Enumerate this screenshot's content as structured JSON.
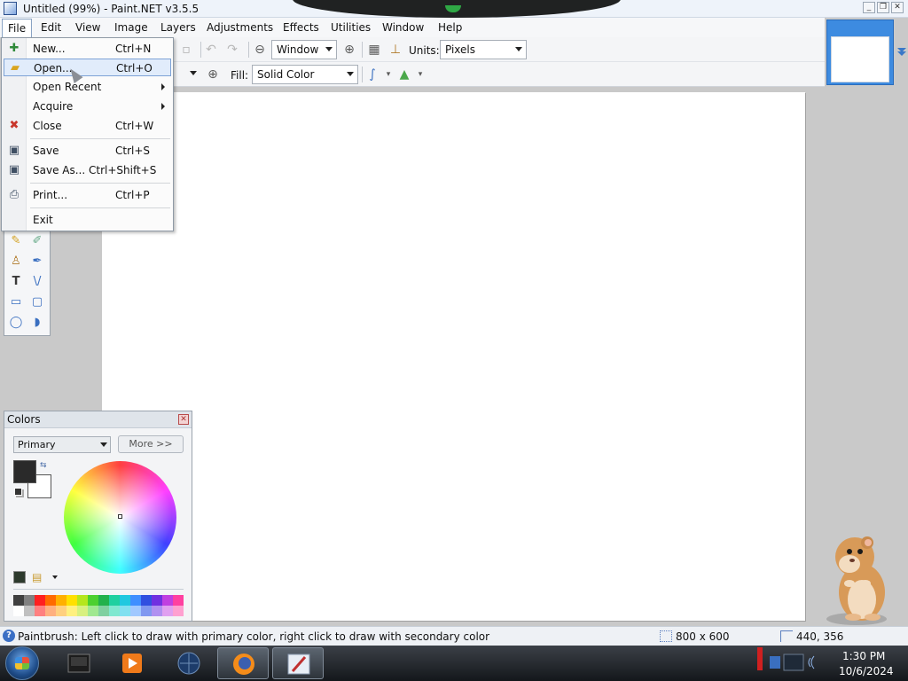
{
  "window": {
    "title": "Untitled (99%) - Paint.NET v3.5.5"
  },
  "menubar": {
    "items": [
      "File",
      "Edit",
      "View",
      "Image",
      "Layers",
      "Adjustments",
      "Effects",
      "Utilities",
      "Window",
      "Help"
    ]
  },
  "toolbar": {
    "zoom_value": "Window",
    "units_label": "Units:",
    "units_value": "Pixels",
    "fill_label": "Fill:",
    "fill_value": "Solid Color"
  },
  "file_menu": {
    "items": [
      {
        "label": "New...",
        "shortcut": "Ctrl+N",
        "icon": "new-document-icon"
      },
      {
        "label": "Open...",
        "shortcut": "Ctrl+O",
        "icon": "open-folder-icon",
        "highlighted": true
      },
      {
        "label": "Open Recent",
        "shortcut": "",
        "submenu": true
      },
      {
        "label": "Acquire",
        "shortcut": "",
        "submenu": true
      },
      {
        "label": "Close",
        "shortcut": "Ctrl+W",
        "icon": "close-document-icon"
      },
      {
        "label": "Save",
        "shortcut": "Ctrl+S",
        "icon": "save-icon"
      },
      {
        "label": "Save As...",
        "shortcut": "Ctrl+Shift+S",
        "icon": "save-as-icon"
      },
      {
        "label": "Print...",
        "shortcut": "Ctrl+P",
        "icon": "print-icon"
      },
      {
        "label": "Exit",
        "shortcut": ""
      }
    ]
  },
  "colors_panel": {
    "title": "Colors",
    "mode": "Primary",
    "more_button": "More >>",
    "primary_color": "#2a2a2a",
    "secondary_color": "#ffffff",
    "palette_row1": [
      "#404040",
      "#808080",
      "#ff2020",
      "#ff6a00",
      "#ffb000",
      "#ffe000",
      "#b5e61d",
      "#4cd030",
      "#22b14c",
      "#20d0a0",
      "#20c8e0",
      "#3f8fff",
      "#3050e0",
      "#7030e0",
      "#c040e0",
      "#ff40a0"
    ],
    "palette_row2": [
      "#ffffff",
      "#c0c0c0",
      "#ff8080",
      "#ffb080",
      "#ffd080",
      "#fff080",
      "#d8f080",
      "#a0e890",
      "#80d0a0",
      "#80e8d0",
      "#80e0f0",
      "#a0c8ff",
      "#8098f0",
      "#b090f0",
      "#e0a0f0",
      "#ffa0d0"
    ]
  },
  "status": {
    "help_text": "Paintbrush: Left click to draw with primary color, right click to draw with secondary color",
    "image_size": "800 x 600",
    "cursor_position": "440, 356"
  },
  "taskbar": {
    "time": "1:30 PM",
    "date": "10/6/2024"
  }
}
